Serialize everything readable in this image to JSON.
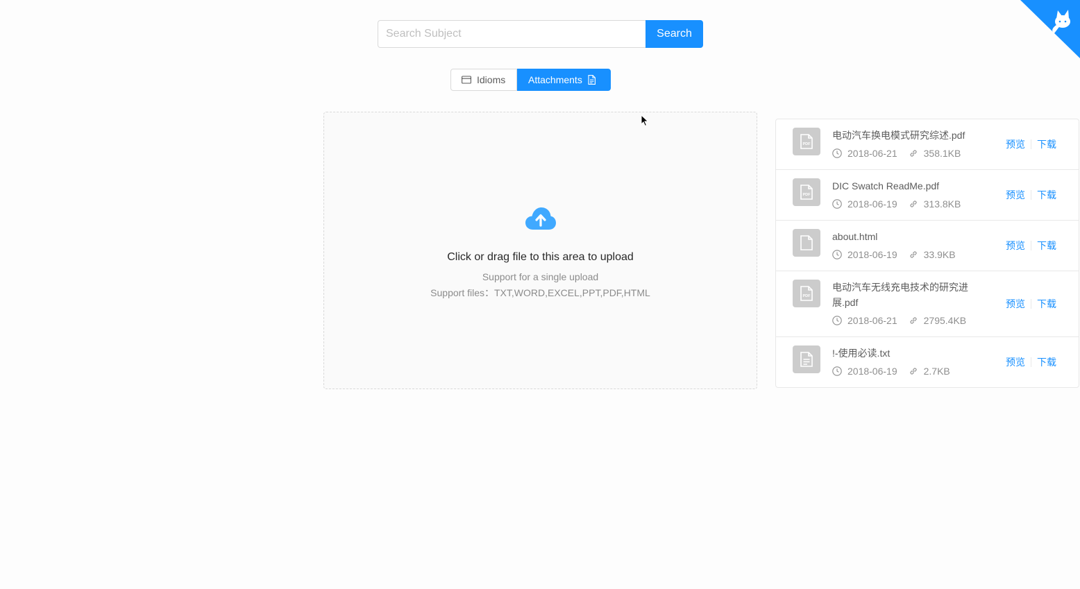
{
  "search": {
    "placeholder": "Search Subject",
    "button_label": "Search"
  },
  "tabs": [
    {
      "label": "Idioms",
      "icon": "credit-card-icon",
      "active": false
    },
    {
      "label": "Attachments",
      "icon": "file-text-icon",
      "active": true
    }
  ],
  "upload": {
    "icon": "cloud-upload-icon",
    "text": "Click or drag file to this area to upload",
    "hint_single": "Support for a single upload",
    "hint_types": "Support files：TXT,WORD,EXCEL,PPT,PDF,HTML"
  },
  "files": [
    {
      "name": "电动汽车换电模式研究综述.pdf",
      "date": "2018-06-21",
      "size": "358.1KB",
      "type_icon": "file-pdf-icon",
      "preview": "预览",
      "download": "下载"
    },
    {
      "name": "DIC Swatch ReadMe.pdf",
      "date": "2018-06-19",
      "size": "313.8KB",
      "type_icon": "file-pdf-icon",
      "preview": "预览",
      "download": "下载"
    },
    {
      "name": "about.html",
      "date": "2018-06-19",
      "size": "33.9KB",
      "type_icon": "file-icon",
      "preview": "预览",
      "download": "下载"
    },
    {
      "name": "电动汽车无线充电技术的研究进展.pdf",
      "date": "2018-06-21",
      "size": "2795.4KB",
      "type_icon": "file-pdf-icon",
      "preview": "预览",
      "download": "下载"
    },
    {
      "name": "!-使用必读.txt",
      "date": "2018-06-19",
      "size": "2.7KB",
      "type_icon": "file-text-icon",
      "preview": "预览",
      "download": "下载"
    }
  ],
  "colors": {
    "primary": "#1890ff",
    "avatar_bg": "#cccccc",
    "border": "#d9d9d9"
  }
}
